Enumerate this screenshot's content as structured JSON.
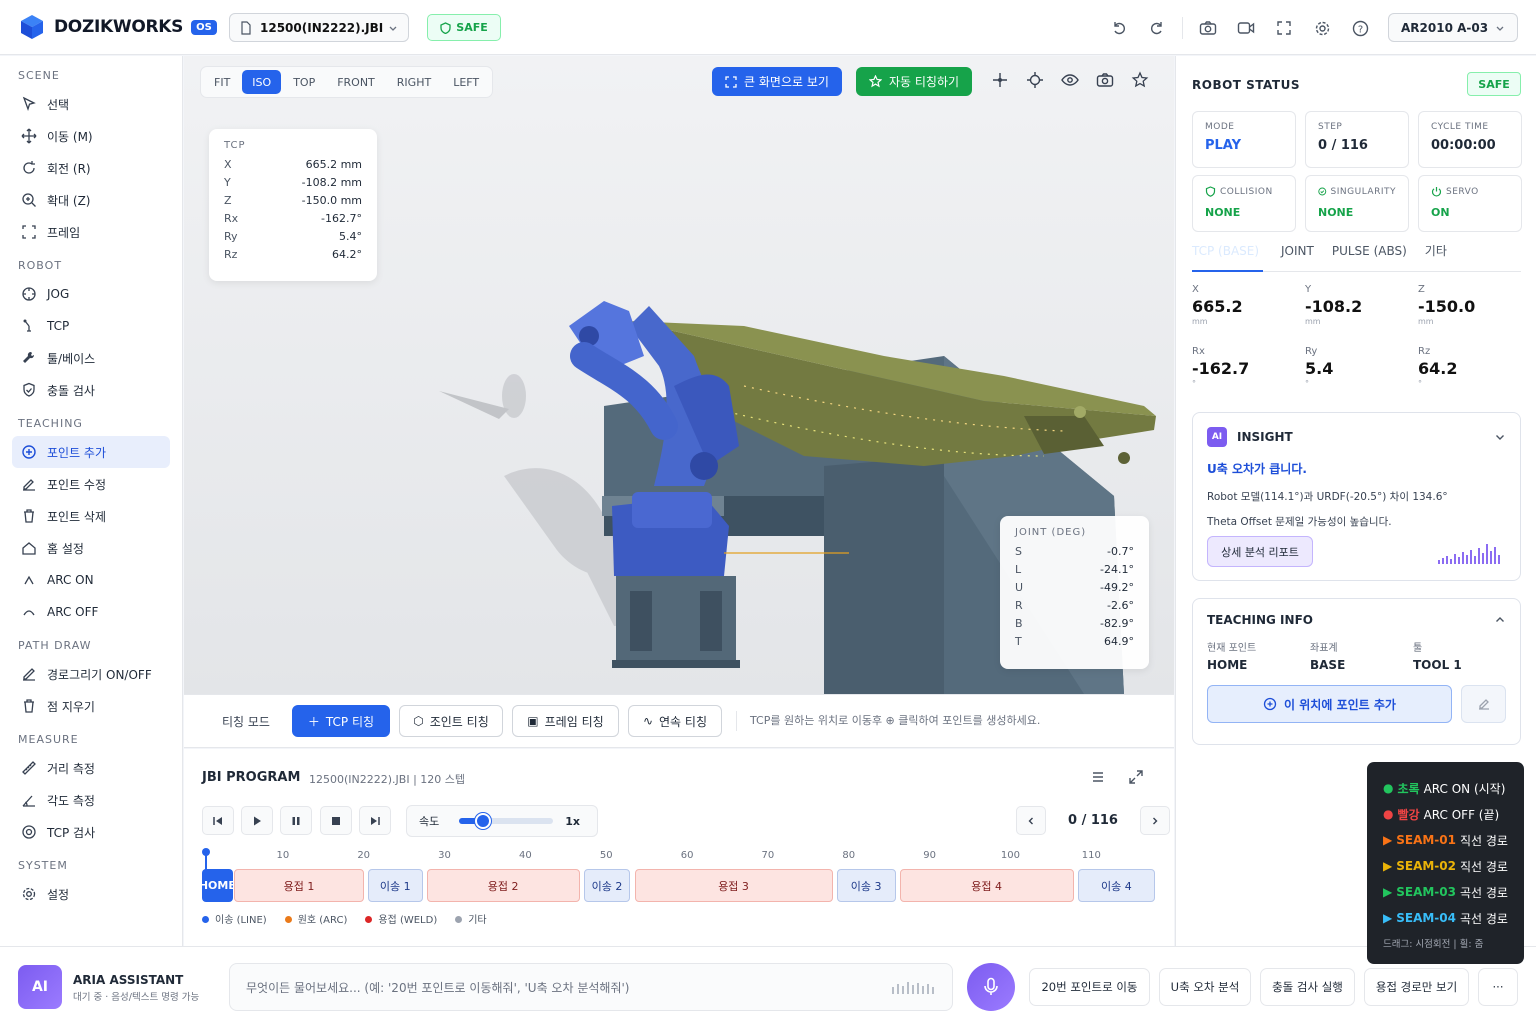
{
  "header": {
    "brand": "DOZIKWORKS",
    "brand_badge": "OS",
    "file": "12500(IN2222).JBI",
    "safe": "SAFE",
    "robot_model": "AR2010 A-03",
    "icons": [
      "undo-icon",
      "redo-icon",
      "camera-icon",
      "video-icon",
      "fullscreen-icon",
      "gear-icon",
      "help-icon"
    ]
  },
  "sidebar": {
    "sections": [
      {
        "title": "SCENE",
        "items": [
          {
            "label": "선택",
            "icon": "cursor-icon"
          },
          {
            "label": "이동 (M)",
            "icon": "move-icon"
          },
          {
            "label": "회전 (R)",
            "icon": "rotate-icon"
          },
          {
            "label": "확대 (Z)",
            "icon": "zoom-icon"
          },
          {
            "label": "프레임",
            "icon": "frame-icon"
          }
        ]
      },
      {
        "title": "ROBOT",
        "items": [
          {
            "label": "JOG",
            "icon": "jog-icon"
          },
          {
            "label": "TCP",
            "icon": "tcp-icon"
          },
          {
            "label": "툴/베이스",
            "icon": "wrench-icon"
          },
          {
            "label": "충돌 검사",
            "icon": "shield-icon"
          }
        ]
      },
      {
        "title": "TEACHING",
        "items": [
          {
            "label": "포인트 추가",
            "icon": "plus-circle-icon",
            "active": true
          },
          {
            "label": "포인트 수정",
            "icon": "edit-icon"
          },
          {
            "label": "포인트 삭제",
            "icon": "trash-icon"
          },
          {
            "label": "홈 설정",
            "icon": "home-icon"
          },
          {
            "label": "ARC ON",
            "icon": "arc-on-icon"
          },
          {
            "label": "ARC OFF",
            "icon": "arc-off-icon"
          }
        ]
      },
      {
        "title": "PATH DRAW",
        "items": [
          {
            "label": "경로그리기 ON/OFF",
            "icon": "pen-icon"
          },
          {
            "label": "점 지우기",
            "icon": "trash-icon"
          }
        ]
      },
      {
        "title": "MEASURE",
        "items": [
          {
            "label": "거리 측정",
            "icon": "ruler-icon"
          },
          {
            "label": "각도 측정",
            "icon": "angle-icon"
          },
          {
            "label": "TCP 검사",
            "icon": "target-icon"
          }
        ]
      },
      {
        "title": "SYSTEM",
        "items": [
          {
            "label": "설정",
            "icon": "gear-icon"
          }
        ]
      }
    ]
  },
  "viewport": {
    "tabs": [
      "FIT",
      "ISO",
      "TOP",
      "FRONT",
      "RIGHT",
      "LEFT"
    ],
    "active_tab": "ISO",
    "fullscreen_btn": "큰 화면으로 보기",
    "auto_teach_btn": "자동 티칭하기",
    "tcp": {
      "title": "TCP",
      "rows": [
        [
          "X",
          "665.2 mm"
        ],
        [
          "Y",
          "-108.2 mm"
        ],
        [
          "Z",
          "-150.0 mm"
        ],
        [
          "Rx",
          "-162.7°"
        ],
        [
          "Ry",
          "5.4°"
        ],
        [
          "Rz",
          "64.2°"
        ]
      ]
    },
    "joint": {
      "title": "JOINT (DEG)",
      "rows": [
        [
          "S",
          "-0.7°"
        ],
        [
          "L",
          "-24.1°"
        ],
        [
          "U",
          "-49.2°"
        ],
        [
          "R",
          "-2.6°"
        ],
        [
          "B",
          "-82.9°"
        ],
        [
          "T",
          "64.9°"
        ]
      ]
    }
  },
  "teach": {
    "label": "티칭 모드",
    "buttons": [
      "TCP 티칭",
      "조인트 티칭",
      "프레임 티칭",
      "연속 티칭"
    ],
    "hint": "TCP를 원하는 위치로 이동후 ⊕ 클릭하여 포인트를 생성하세요."
  },
  "program": {
    "title": "JBI PROGRAM",
    "sub": "12500(IN2222).JBI | 120 스텝",
    "speed_label": "속도",
    "speed_value": "1x",
    "speed_fraction": 0.25,
    "position": "0 / 116",
    "ticks": [
      "10",
      "20",
      "30",
      "40",
      "50",
      "60",
      "70",
      "80",
      "90",
      "100",
      "110"
    ],
    "segments": [
      {
        "label": "HOME",
        "type": "home",
        "start": 0,
        "end": 3.8
      },
      {
        "label": "용접 1",
        "type": "weld",
        "start": 4,
        "end": 20
      },
      {
        "label": "이송 1",
        "type": "move",
        "start": 20.5,
        "end": 27.3
      },
      {
        "label": "용접 2",
        "type": "weld",
        "start": 27.8,
        "end": 46.7
      },
      {
        "label": "이송 2",
        "type": "move",
        "start": 47.2,
        "end": 53
      },
      {
        "label": "용접 3",
        "type": "weld",
        "start": 53.5,
        "end": 78
      },
      {
        "label": "이송 3",
        "type": "move",
        "start": 78.5,
        "end": 85.8
      },
      {
        "label": "용접 4",
        "type": "weld",
        "start": 86.3,
        "end": 107.8
      },
      {
        "label": "이송 4",
        "type": "move",
        "start": 108.3,
        "end": 117.9
      }
    ],
    "legend": [
      {
        "label": "이송 (LINE)",
        "color": "#2563eb"
      },
      {
        "label": "원호 (ARC)",
        "color": "#ea7a1a"
      },
      {
        "label": "용접 (WELD)",
        "color": "#dc2626"
      },
      {
        "label": "기타",
        "color": "#9ca3af"
      }
    ]
  },
  "status": {
    "title": "ROBOT STATUS",
    "safe": "SAFE",
    "cards": [
      {
        "label": "MODE",
        "value": "PLAY"
      },
      {
        "label": "STEP",
        "value": "0 / 116"
      },
      {
        "label": "CYCLE TIME",
        "value": "00:00:00"
      },
      {
        "label": "COLLISION",
        "value": "NONE"
      },
      {
        "label": "SINGULARITY",
        "value": "NONE"
      },
      {
        "label": "SERVO",
        "value": "ON"
      }
    ],
    "tabs": [
      "TCP (BASE)",
      "JOINT",
      "PULSE (ABS)",
      "기타"
    ],
    "coords": [
      {
        "label": "X",
        "value": "665.2",
        "unit": "mm"
      },
      {
        "label": "Y",
        "value": "-108.2",
        "unit": "mm"
      },
      {
        "label": "Z",
        "value": "-150.0",
        "unit": "mm"
      },
      {
        "label": "Rx",
        "value": "-162.7",
        "unit": "°"
      },
      {
        "label": "Ry",
        "value": "5.4",
        "unit": "°"
      },
      {
        "label": "Rz",
        "value": "64.2",
        "unit": "°"
      }
    ]
  },
  "insight": {
    "badge": "AI",
    "title": "INSIGHT",
    "headline": "U축 오차가 큽니다.",
    "line1": "Robot 모델(114.1°)과 URDF(-20.5°) 차이 134.6°",
    "line2": "Theta Offset 문제일 가능성이 높습니다.",
    "button": "상세 분석 리포트"
  },
  "teaching_info": {
    "title": "TEACHING INFO",
    "cols": [
      {
        "label": "현재 포인트",
        "value": "HOME"
      },
      {
        "label": "좌표계",
        "value": "BASE"
      },
      {
        "label": "툴",
        "value": "TOOL 1"
      }
    ],
    "add_button": "이 위치에 포인트 추가"
  },
  "tooltip": {
    "rows": [
      {
        "marker": "●",
        "key": "초록",
        "text": "ARC ON (시작)",
        "color": "#22c55e"
      },
      {
        "marker": "●",
        "key": "빨강",
        "text": "ARC OFF (끝)",
        "color": "#ef4444"
      },
      {
        "marker": "▶",
        "key": "SEAM-01",
        "text": "직선 경로",
        "color": "#f97316"
      },
      {
        "marker": "▶",
        "key": "SEAM-02",
        "text": "직선 경로",
        "color": "#eab308"
      },
      {
        "marker": "▶",
        "key": "SEAM-03",
        "text": "곡선 경로",
        "color": "#22c55e"
      },
      {
        "marker": "▶",
        "key": "SEAM-04",
        "text": "곡선 경로",
        "color": "#38bdf8"
      }
    ],
    "hint": "드래그: 시점회전 | 휠: 줌"
  },
  "assistant": {
    "avatar": "AI",
    "name": "ARIA ASSISTANT",
    "sub": "대기 중 · 음성/텍스트 명령 가능",
    "placeholder": "무엇이든 물어보세요... (예: '20번 포인트로 이동해줘', 'U축 오차 분석해줘')",
    "quick": [
      "20번 포인트로 이동",
      "U축 오차 분석",
      "충돌 검사 실행",
      "용접 경로만 보기"
    ],
    "more": "···"
  }
}
